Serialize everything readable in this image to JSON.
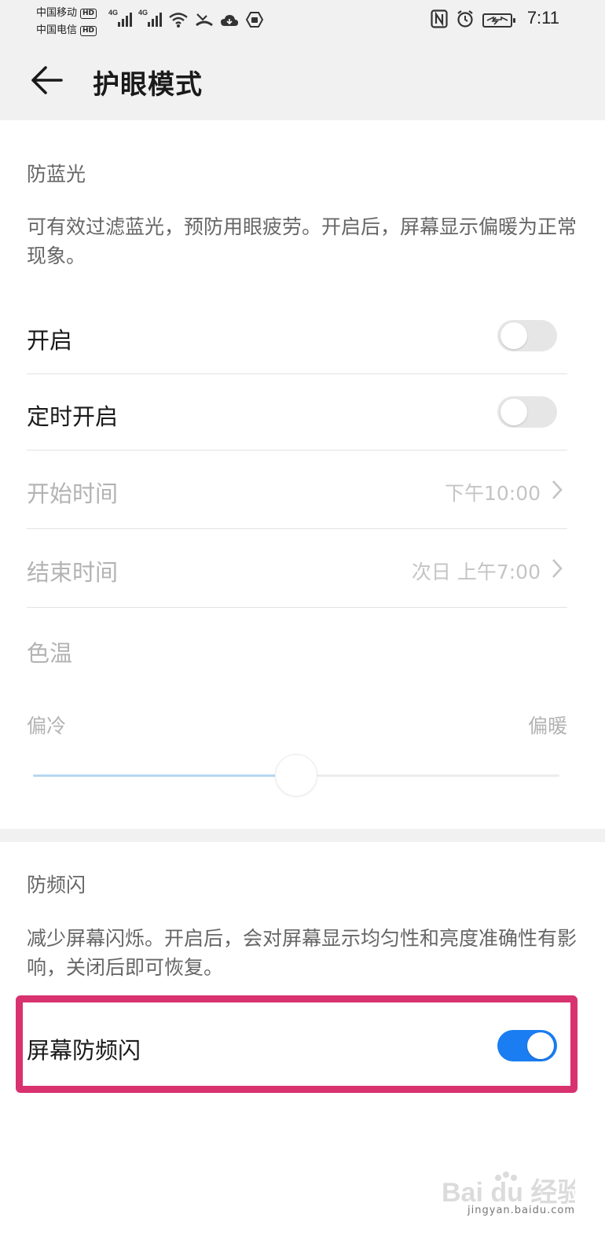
{
  "status_bar": {
    "carrier1": "中国移动",
    "carrier2": "中国电信",
    "hd_badge": "HD",
    "network1": "4G",
    "network2": "4G",
    "time": "7:11",
    "icons": [
      "signal-bars-icon",
      "wifi-icon",
      "missed-call-icon",
      "cloud-icon",
      "shield-icon",
      "nfc-icon",
      "alarm-icon",
      "battery-icon"
    ]
  },
  "header": {
    "title": "护眼模式"
  },
  "blue_light": {
    "heading": "防蓝光",
    "description": "可有效过滤蓝光，预防用眼疲劳。开启后，屏幕显示偏暖为正常现象。",
    "enable": {
      "label": "开启",
      "on": false
    },
    "schedule": {
      "label": "定时开启",
      "on": false
    },
    "start_time": {
      "label": "开始时间",
      "value": "下午10:00"
    },
    "end_time": {
      "label": "结束时间",
      "value": "次日 上午7:00"
    },
    "color_temp": {
      "label": "色温",
      "min_label": "偏冷",
      "max_label": "偏暖",
      "level": 0.5
    }
  },
  "flicker": {
    "heading": "防频闪",
    "description": "减少屏幕闪烁。开启后，会对屏幕显示均匀性和亮度准确性有影响，关闭后即可恢复。",
    "toggle": {
      "label": "屏幕防频闪",
      "on": true
    }
  },
  "watermark": {
    "brand": "Bai du 经验",
    "site": "jingyan.baidu.com"
  },
  "colors": {
    "accent": "#1a7df2",
    "highlight": "#d8326f",
    "slider_fill": "#b7d7f1"
  }
}
